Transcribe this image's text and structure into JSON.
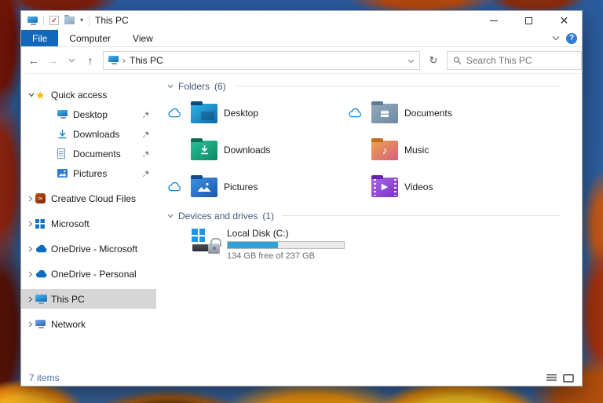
{
  "window": {
    "title": "This PC",
    "quick_access_toolbar": {
      "buttons": [
        "this-pc",
        "properties",
        "new-folder",
        "customize-dropdown"
      ]
    },
    "controls": [
      "minimize",
      "maximize",
      "close"
    ]
  },
  "ribbon": {
    "tabs": [
      {
        "label": "File",
        "active": true
      },
      {
        "label": "Computer",
        "active": false
      },
      {
        "label": "View",
        "active": false
      }
    ],
    "help_label": "?"
  },
  "toolbar": {
    "breadcrumb": {
      "root": "This PC",
      "separator": "›"
    },
    "search": {
      "placeholder": "Search This PC"
    }
  },
  "sidebar": {
    "quick_access": {
      "label": "Quick access",
      "icon": "star-icon",
      "items": [
        {
          "label": "Desktop",
          "icon": "desktop-icon",
          "pinned": true
        },
        {
          "label": "Downloads",
          "icon": "downloads-icon",
          "pinned": true
        },
        {
          "label": "Documents",
          "icon": "documents-icon",
          "pinned": true
        },
        {
          "label": "Pictures",
          "icon": "pictures-icon",
          "pinned": true
        }
      ]
    },
    "roots": [
      {
        "label": "Creative Cloud Files",
        "icon": "creative-cloud-icon",
        "selected": false
      },
      {
        "label": "Microsoft",
        "icon": "microsoft-icon",
        "selected": false
      },
      {
        "label": "OneDrive - Microsoft",
        "icon": "onedrive-icon",
        "selected": false
      },
      {
        "label": "OneDrive - Personal",
        "icon": "onedrive-icon",
        "selected": false
      },
      {
        "label": "This PC",
        "icon": "this-pc-icon",
        "selected": true
      },
      {
        "label": "Network",
        "icon": "network-icon",
        "selected": false
      }
    ]
  },
  "main": {
    "folders": {
      "label": "Folders",
      "count": "(6)",
      "items": [
        {
          "label": "Desktop",
          "cloud": true,
          "c1": "#31b7ea",
          "c2": "#0f67a9",
          "tab": "#0b4a7a"
        },
        {
          "label": "Downloads",
          "cloud": false,
          "c1": "#25c29a",
          "c2": "#0e8763",
          "tab": "#0a6b4f"
        },
        {
          "label": "Pictures",
          "cloud": true,
          "c1": "#3f93e8",
          "c2": "#1b57a8",
          "tab": "#144a8f"
        },
        {
          "label": "Documents",
          "cloud": true,
          "c1": "#93a9bc",
          "c2": "#6d8aa4",
          "tab": "#5d7a93"
        },
        {
          "label": "Music",
          "cloud": false,
          "c1": "#eda04e",
          "c2": "#d8617e",
          "tab": "#bf6f1f"
        },
        {
          "label": "Videos",
          "cloud": false,
          "c1": "#a869e3",
          "c2": "#7c2fc9",
          "tab": "#6a25b0"
        }
      ]
    },
    "devices": {
      "label": "Devices and drives",
      "count": "(1)",
      "drive": {
        "label": "Local Disk (C:)",
        "free_text": "134 GB free of 237 GB",
        "used_percent": 43,
        "bar_color": "#33a1d9"
      }
    }
  },
  "statusbar": {
    "items_count": "7 items",
    "views": [
      "details-view",
      "large-icons-view"
    ]
  }
}
